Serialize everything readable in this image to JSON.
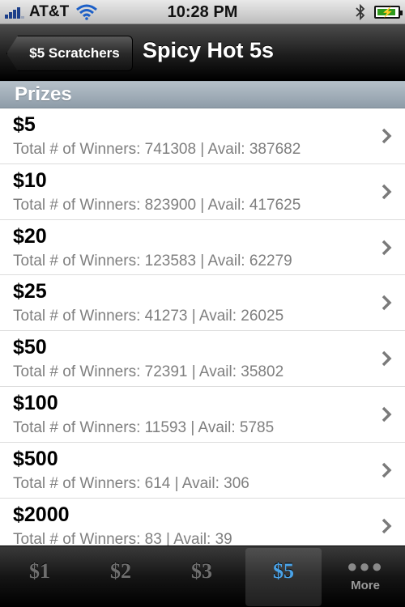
{
  "status_bar": {
    "carrier": "AT&T",
    "time": "10:28 PM"
  },
  "nav": {
    "back_label": "$5 Scratchers",
    "title": "Spicy Hot 5s"
  },
  "section": {
    "header": "Prizes"
  },
  "prizes": [
    {
      "amount": "$5",
      "details": "Total # of Winners: 741308 | Avail: 387682"
    },
    {
      "amount": "$10",
      "details": "Total # of Winners: 823900 | Avail: 417625"
    },
    {
      "amount": "$20",
      "details": "Total # of Winners: 123583 | Avail: 62279"
    },
    {
      "amount": "$25",
      "details": "Total # of Winners: 41273 | Avail: 26025"
    },
    {
      "amount": "$50",
      "details": "Total # of Winners: 72391 | Avail: 35802"
    },
    {
      "amount": "$100",
      "details": "Total # of Winners: 11593 | Avail: 5785"
    },
    {
      "amount": "$500",
      "details": "Total # of Winners: 614 | Avail: 306"
    },
    {
      "amount": "$2000",
      "details": "Total # of Winners: 83 | Avail: 39"
    }
  ],
  "tabs": [
    {
      "label": "$1",
      "active": false
    },
    {
      "label": "$2",
      "active": false
    },
    {
      "label": "$3",
      "active": false
    },
    {
      "label": "$5",
      "active": true
    },
    {
      "label": "More",
      "active": false
    }
  ],
  "colors": {
    "active_tab": "#4aa3e8",
    "section_header": "#9aa7b2"
  }
}
